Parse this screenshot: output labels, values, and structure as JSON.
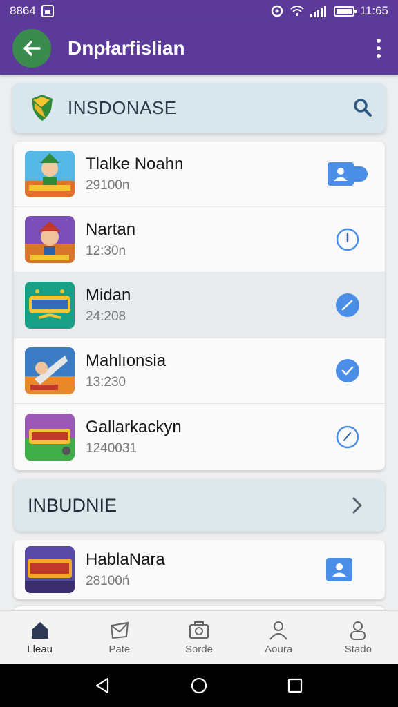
{
  "status_bar": {
    "left_text": "8864",
    "time": "11:65"
  },
  "app_bar": {
    "title": "Dnpłarfislian",
    "back_icon": "arrow-left-icon",
    "menu_icon": "more-vertical-icon"
  },
  "search": {
    "text": "INSDONASE",
    "icon": "search-icon"
  },
  "list": {
    "items": [
      {
        "title": "Tlalke Noahn",
        "subtitle": "29100n",
        "action": "contact-card-icon",
        "selected": false
      },
      {
        "title": "Nartan",
        "subtitle": "12:30n",
        "action": "clock-outline-icon",
        "selected": false
      },
      {
        "title": "Midan",
        "subtitle": "24:208",
        "action": "check-circle-icon",
        "selected": true
      },
      {
        "title": "Mahlıonsia",
        "subtitle": "13:230",
        "action": "check-circle-icon",
        "selected": false
      },
      {
        "title": "Gallarkackyn",
        "subtitle": "1240031",
        "action": "clock-outline-icon",
        "selected": false
      }
    ]
  },
  "section": {
    "title": "INBUDNIE",
    "icon": "chevron-right-icon"
  },
  "single_item": {
    "title": "HablaNara",
    "subtitle": "28100ń",
    "action": "contact-card-icon"
  },
  "bottom_nav": {
    "items": [
      {
        "label": "Lleau",
        "icon": "home-icon"
      },
      {
        "label": "Pate",
        "icon": "mail-icon"
      },
      {
        "label": "Sorde",
        "icon": "camera-icon"
      },
      {
        "label": "Aoura",
        "icon": "person-icon"
      },
      {
        "label": "Stado",
        "icon": "profile-icon"
      }
    ]
  },
  "colors": {
    "primary": "#5b3a9a",
    "back_button": "#3b8a4e",
    "accent_blue": "#4a8ee8",
    "search_bg": "#d9e6ee"
  }
}
